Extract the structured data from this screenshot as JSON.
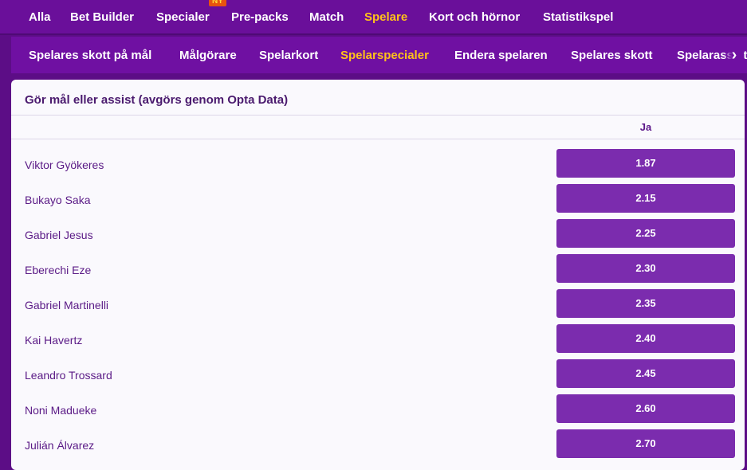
{
  "top_nav": {
    "items": [
      "Alla",
      "Bet Builder",
      "Specialer",
      "Pre-packs",
      "Match",
      "Spelare",
      "Kort och hörnor",
      "Statistikspel"
    ],
    "active": "Spelare",
    "badge": "NY"
  },
  "sub_nav": {
    "items": [
      "Spelares skott på mål",
      "Målgörare",
      "Spelarkort",
      "Spelarspecialer",
      "Endera spelaren",
      "Spelares skott",
      "Spelarassists"
    ],
    "active": "Spelarspecialer",
    "scroll_icon": "chevron-right-icon"
  },
  "market": {
    "title": "Gör mål eller assist (avgörs genom Opta Data)",
    "column_header": "Ja",
    "rows": [
      {
        "player": "Viktor Gyökeres",
        "odds": "1.87"
      },
      {
        "player": "Bukayo Saka",
        "odds": "2.15"
      },
      {
        "player": "Gabriel Jesus",
        "odds": "2.25"
      },
      {
        "player": "Eberechi Eze",
        "odds": "2.30"
      },
      {
        "player": "Gabriel Martinelli",
        "odds": "2.35"
      },
      {
        "player": "Kai Havertz",
        "odds": "2.40"
      },
      {
        "player": "Leandro Trossard",
        "odds": "2.45"
      },
      {
        "player": "Noni Madueke",
        "odds": "2.60"
      },
      {
        "player": "Julián Álvarez",
        "odds": "2.70"
      }
    ]
  },
  "colors": {
    "active_tab": "#ffc21a",
    "odds_button": "#7b2cae",
    "nav_background": "#6a0f9a"
  }
}
